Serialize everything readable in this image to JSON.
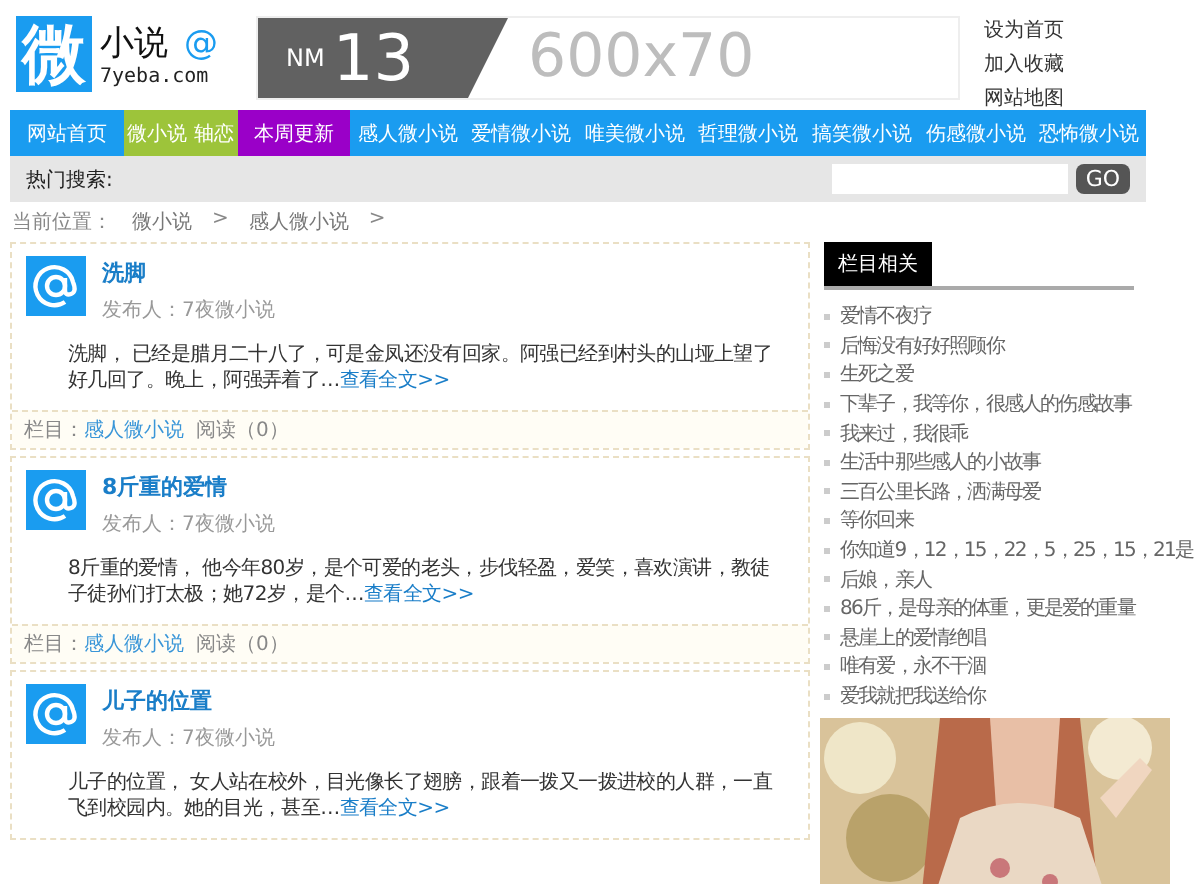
{
  "header": {
    "logo_char": "微",
    "logo_title": "小说",
    "logo_mark": "@",
    "logo_domain": "7yeba.com",
    "banner_prefix": "NM",
    "banner_number": "13",
    "banner_size": "600x70",
    "links": [
      "设为首页",
      "加入收藏",
      "网站地图"
    ]
  },
  "nav": [
    {
      "label": "网站首页",
      "color": "#1a9cf0"
    },
    {
      "label": "微小说 轴恋",
      "color": "#9dc43a"
    },
    {
      "label": "本周更新",
      "color": "#9a00c8"
    },
    {
      "label": "感人微小说",
      "color": "#1a9cf0"
    },
    {
      "label": "爱情微小说",
      "color": "#1a9cf0"
    },
    {
      "label": "唯美微小说",
      "color": "#1a9cf0"
    },
    {
      "label": "哲理微小说",
      "color": "#1a9cf0"
    },
    {
      "label": "搞笑微小说",
      "color": "#1a9cf0"
    },
    {
      "label": "伤感微小说",
      "color": "#1a9cf0"
    },
    {
      "label": "恐怖微小说",
      "color": "#1a9cf0"
    }
  ],
  "search": {
    "label": "热门搜索:",
    "button": "GO"
  },
  "breadcrumb": {
    "label": "当前位置：",
    "items": [
      "微小说",
      "感人微小说"
    ],
    "separator": ">"
  },
  "articles": [
    {
      "title": "洗脚",
      "author": "发布人：7夜微小说",
      "body": "洗脚， 已经是腊月二十八了，可是金凤还没有回家。阿强已经到村头的山垭上望了好几回了。晚上，阿强弄着了…",
      "more": "查看全文>>",
      "meta": {
        "label": "栏目：",
        "category": "感人微小说",
        "reads": "阅读（0）"
      }
    },
    {
      "title": "8斤重的爱情",
      "author": "发布人：7夜微小说",
      "body": "8斤重的爱情， 他今年80岁，是个可爱的老头，步伐轻盈，爱笑，喜欢演讲，教徒子徒孙们打太极；她72岁，是个…",
      "more": "查看全文>>",
      "meta": {
        "label": "栏目：",
        "category": "感人微小说",
        "reads": "阅读（0）"
      }
    },
    {
      "title": "儿子的位置",
      "author": "发布人：7夜微小说",
      "body": "儿子的位置， 女人站在校外，目光像长了翅膀，跟着一拨又一拨进校的人群，一直飞到校园内。她的目光，甚至…",
      "more": "查看全文>>"
    }
  ],
  "sidebar": {
    "heading": "栏目相关",
    "items": [
      "爱情不夜疗",
      "后悔没有好好照顾你",
      "生死之爱",
      "下辈子，我等你，很感人的伤感故事",
      "我来过，我很乖",
      "生活中那些感人的小故事",
      "三百公里长路，洒满母爱",
      "等你回来",
      "你知道9，12，15，22，5，25，15，21是",
      "后娘，亲人",
      "86斤，是母亲的体重，更是爱的重量",
      "悬崖上的爱情绝唱",
      "唯有爱，永不干涸",
      "爱我就把我送给你"
    ]
  }
}
